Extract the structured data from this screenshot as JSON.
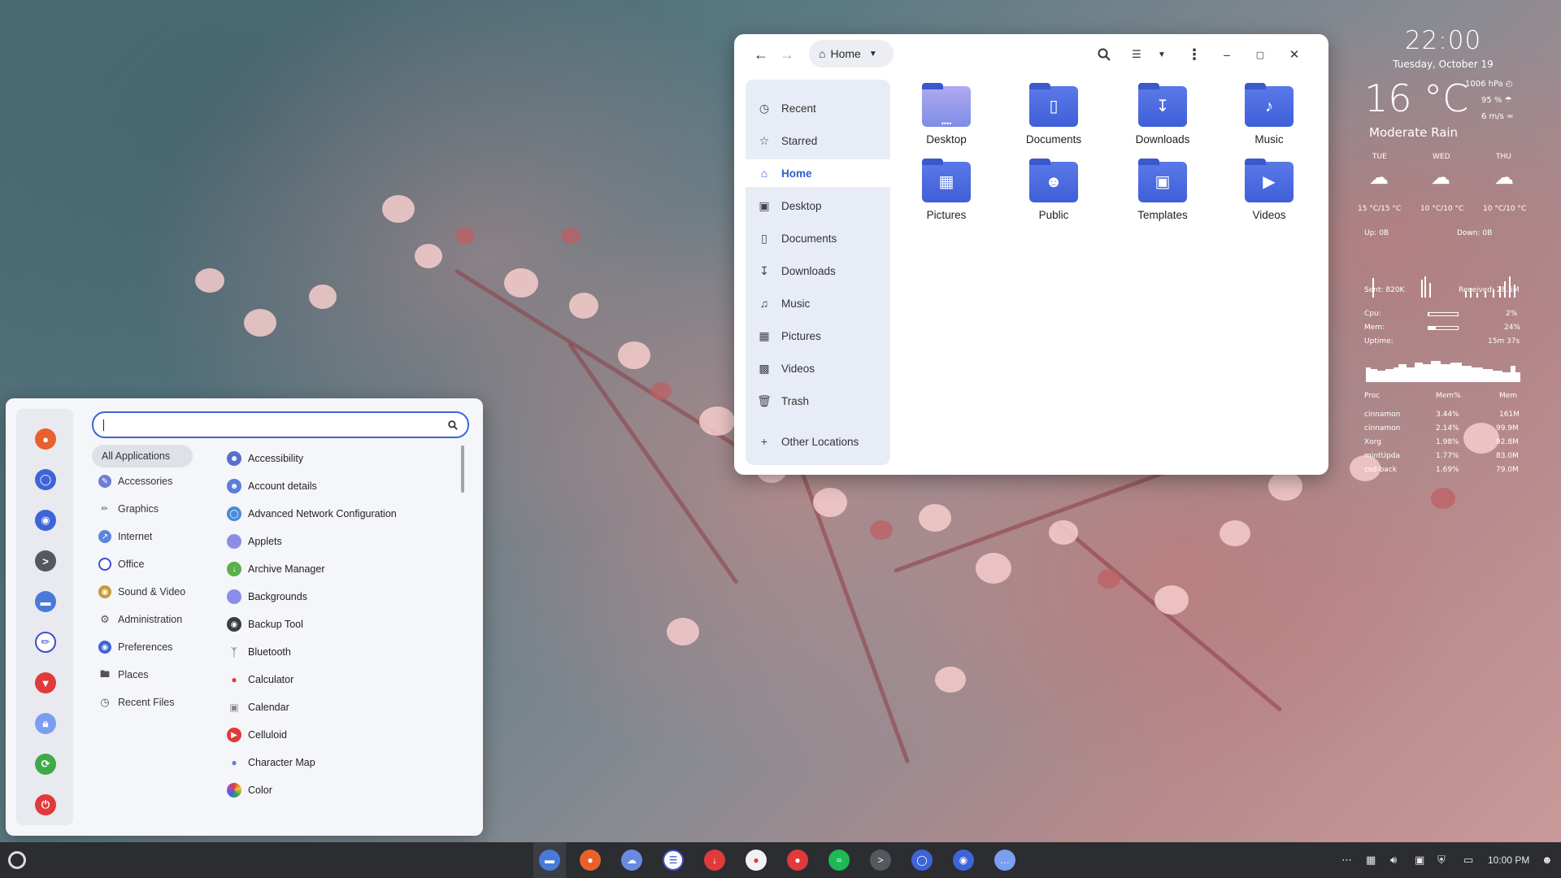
{
  "file_manager": {
    "path_label": "Home",
    "sidebar": [
      {
        "label": "Recent",
        "icon": "clock-icon"
      },
      {
        "label": "Starred",
        "icon": "star-icon"
      },
      {
        "label": "Home",
        "icon": "home-icon"
      },
      {
        "label": "Desktop",
        "icon": "desktop-icon"
      },
      {
        "label": "Documents",
        "icon": "document-icon"
      },
      {
        "label": "Downloads",
        "icon": "download-icon"
      },
      {
        "label": "Music",
        "icon": "music-icon"
      },
      {
        "label": "Pictures",
        "icon": "picture-icon"
      },
      {
        "label": "Videos",
        "icon": "video-icon"
      },
      {
        "label": "Trash",
        "icon": "trash-icon"
      },
      {
        "label": "Other Locations",
        "icon": "plus-icon"
      }
    ],
    "folders": [
      "Desktop",
      "Documents",
      "Downloads",
      "Music",
      "Pictures",
      "Public",
      "Templates",
      "Videos"
    ]
  },
  "conky": {
    "time": "22:00",
    "date": "Tuesday, October 19",
    "temperature": "16 °C",
    "pressure": "1006 hPa",
    "humidity": "95 %",
    "wind": "6 m/s",
    "condition": "Moderate Rain",
    "forecast": [
      {
        "day": "TUE",
        "range": "15 °C/15 °C"
      },
      {
        "day": "WED",
        "range": "10 °C/10 °C"
      },
      {
        "day": "THU",
        "range": "10 °C/10 °C"
      }
    ],
    "up": "Up: 0B",
    "down": "Down: 0B",
    "sent": "Sent: 820K",
    "received": "Received: 28.5M",
    "cpu_label": "Cpu:",
    "cpu_value": "2%",
    "cpu_fraction": 0.02,
    "mem_label": "Mem:",
    "mem_value": "24%",
    "mem_fraction": 0.24,
    "uptime_label": "Uptime:",
    "uptime_value": "15m 37s",
    "proc_headers": [
      "Proc",
      "Mem%",
      "Mem"
    ],
    "procs": [
      [
        "cinnamon",
        "3.44%",
        "161M"
      ],
      [
        "cinnamon",
        "2.14%",
        "99.9M"
      ],
      [
        "Xorg",
        "1.98%",
        "92.8M"
      ],
      [
        "mintUpda",
        "1.77%",
        "83.0M"
      ],
      [
        "csd-back",
        "1.69%",
        "79.0M"
      ]
    ]
  },
  "menu": {
    "search_value": "",
    "categories": [
      "All Applications",
      "Accessories",
      "Graphics",
      "Internet",
      "Office",
      "Sound & Video",
      "Administration",
      "Preferences",
      "Places",
      "Recent Files"
    ],
    "apps": [
      "Accessibility",
      "Account details",
      "Advanced Network Configuration",
      "Applets",
      "Archive Manager",
      "Backgrounds",
      "Backup Tool",
      "Bluetooth",
      "Calculator",
      "Calendar",
      "Celluloid",
      "Character Map",
      "Color"
    ]
  },
  "taskbar": {
    "clock": "10:00 PM"
  },
  "colors": {
    "accent": "#3d64d8",
    "folder": "#4a68dc"
  }
}
